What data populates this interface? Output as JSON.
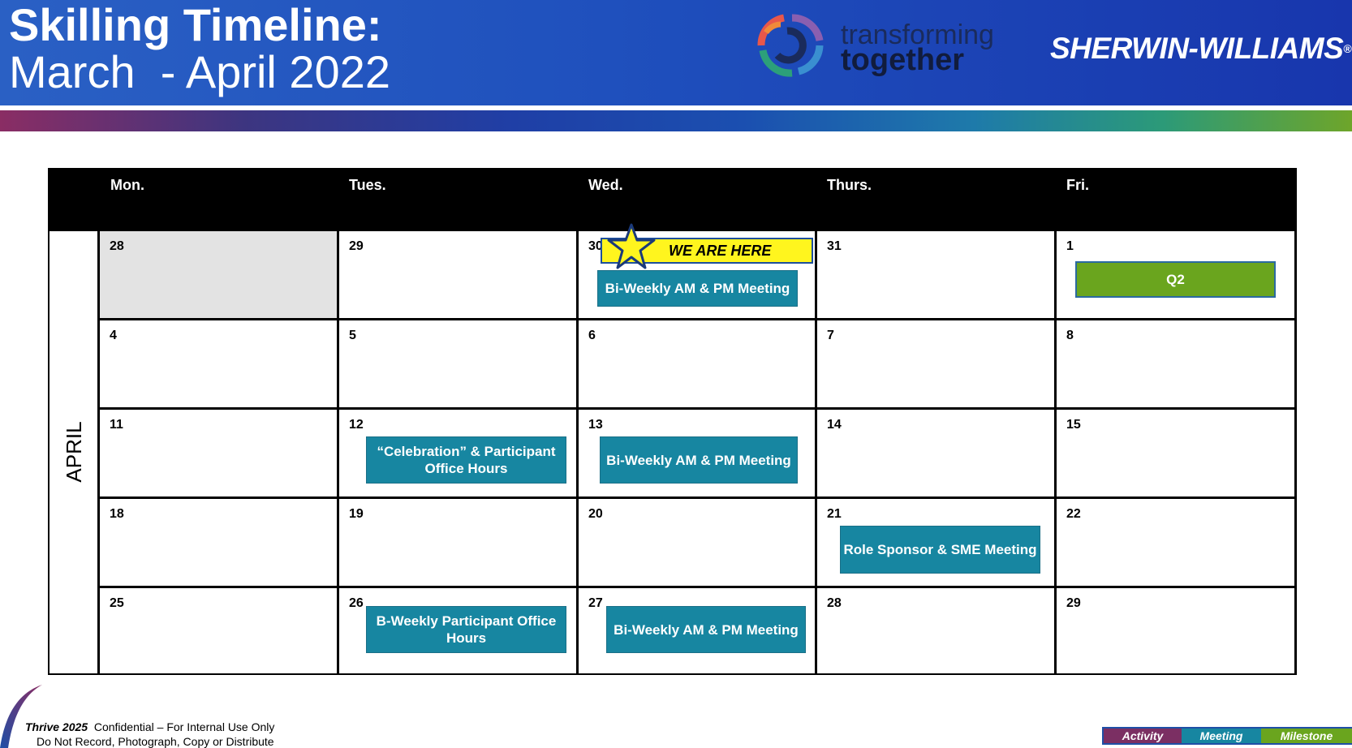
{
  "header": {
    "title_line1": "Skilling Timeline:",
    "title_line2": "March  - April 2022",
    "logo_transforming": "transforming",
    "logo_together": "together",
    "logo_brand": "SHERWIN-WILLIAMS",
    "logo_brand_mark": "®"
  },
  "calendar": {
    "days": [
      "Mon.",
      "Tues.",
      "Wed.",
      "Thurs.",
      "Fri."
    ],
    "month_label": "APRIL",
    "weeks": [
      [
        "28",
        "29",
        "30",
        "31",
        "1"
      ],
      [
        "4",
        "5",
        "6",
        "7",
        "8"
      ],
      [
        "11",
        "12",
        "13",
        "14",
        "15"
      ],
      [
        "18",
        "19",
        "20",
        "21",
        "22"
      ],
      [
        "25",
        "26",
        "27",
        "28",
        "29"
      ]
    ],
    "marker": "WE ARE HERE",
    "events": {
      "w1_wed": "Bi-Weekly AM & PM Meeting",
      "w1_fri": "Q2",
      "w3_tue": "“Celebration” & Participant Office Hours",
      "w3_wed": "Bi-Weekly AM & PM Meeting",
      "w4_thu": "Role Sponsor & SME Meeting",
      "w5_tue": "B-Weekly Participant Office Hours",
      "w5_wed": "Bi-Weekly AM & PM Meeting"
    }
  },
  "footer": {
    "brand": "Thrive 2025",
    "confidential": "  Confidential – For Internal Use Only",
    "notice": "Do Not Record, Photograph, Copy or Distribute"
  },
  "legend": {
    "activity": "Activity",
    "meeting": "Meeting",
    "milestone": "Milestone"
  },
  "colors": {
    "activity": "#7b2f63",
    "meeting": "#1786a1",
    "milestone": "#6aa51e",
    "header_blue": "#2255c0",
    "marker_yellow": "#fff51e"
  }
}
